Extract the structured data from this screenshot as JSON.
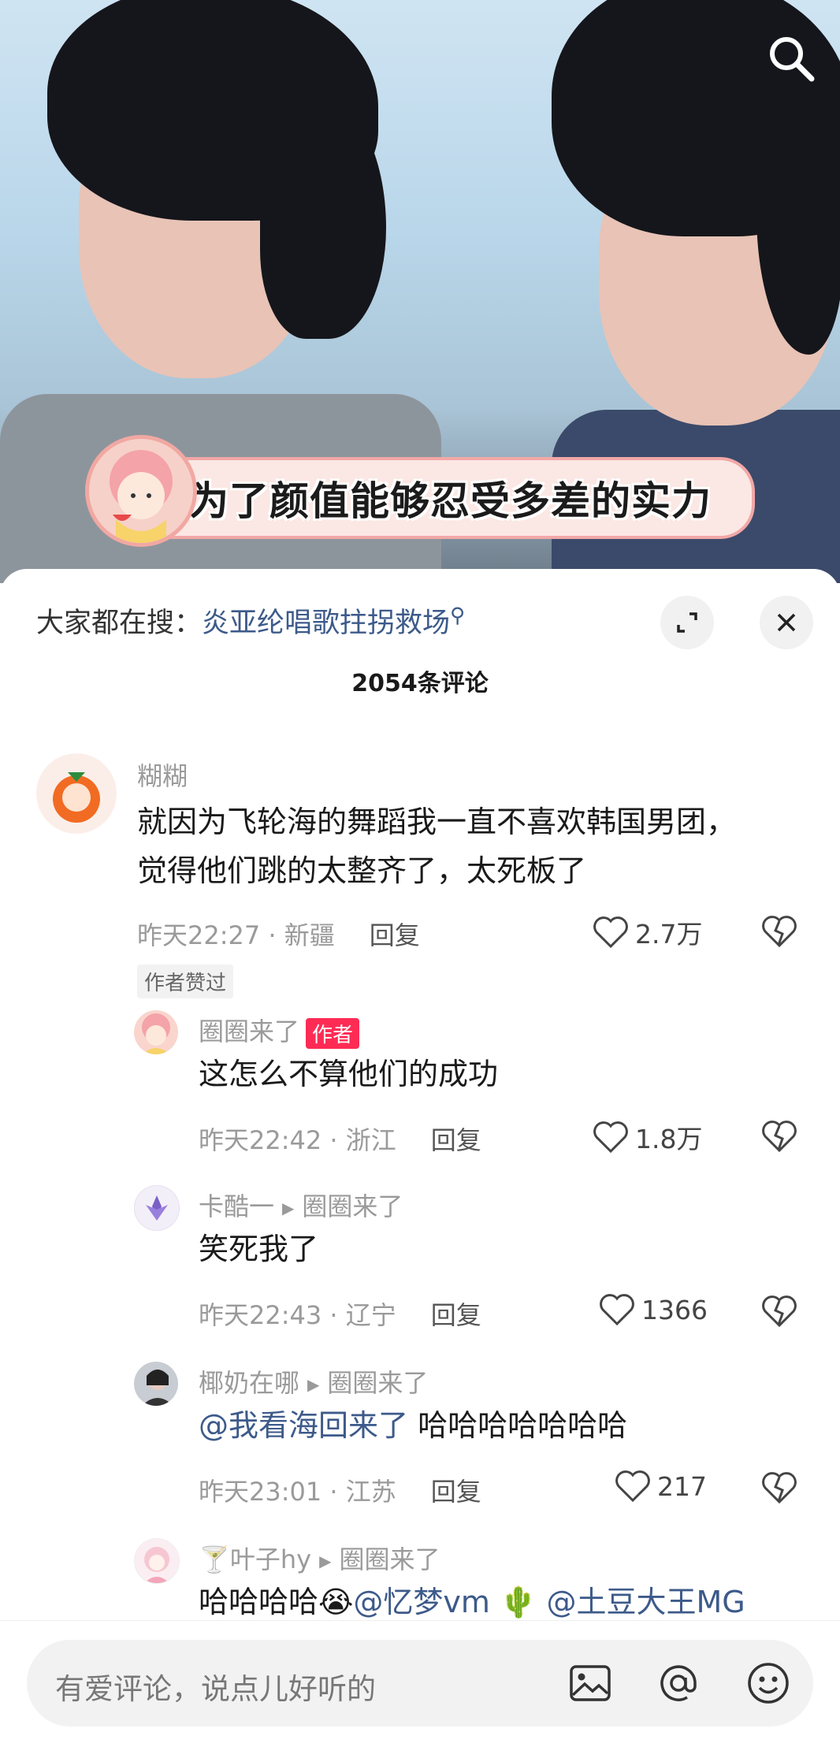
{
  "video": {
    "caption": "为了颜值能够忍受多差的实力"
  },
  "sheet": {
    "hot_search_label": "大家都在搜：",
    "hot_search_query": "炎亚纶唱歌拄拐救场",
    "comment_count": "2054条评论"
  },
  "comments": [
    {
      "user": "糊糊",
      "text_lines": [
        "就因为飞轮海的舞蹈我一直不喜欢韩国男团，",
        "觉得他们跳的太整齐了，太死板了"
      ],
      "time_loc": "昨天22:27 · 新疆",
      "reply": "回复",
      "likes": "2.7万",
      "badge": "作者赞过"
    },
    {
      "user": "圈圈来了",
      "tag": "作者",
      "text": "这怎么不算他们的成功",
      "time_loc": "昨天22:42 · 浙江",
      "reply": "回复",
      "likes": "1.8万"
    },
    {
      "user": "卡酷一",
      "reply_to": "圈圈来了",
      "text": "笑死我了",
      "time_loc": "昨天22:43 · 辽宁",
      "reply": "回复",
      "likes": "1366"
    },
    {
      "user": "椰奶在哪",
      "reply_to": "圈圈来了",
      "mention": "@我看海回来了",
      "text": " 哈哈哈哈哈哈哈",
      "time_loc": "昨天23:01 · 江苏",
      "reply": "回复",
      "likes": "217"
    },
    {
      "user": "叶子hy",
      "user_prefix": "🍸",
      "reply_to": "圈圈来了",
      "text": "哈哈哈哈😭",
      "mention1": "@忆梦vm",
      "emoji": "🌵",
      "mention2": "@土豆大王MG"
    }
  ],
  "input": {
    "placeholder": "有爱评论，说点儿好听的"
  },
  "icons": [
    "search-icon",
    "expand-icon",
    "close-icon",
    "heart-icon",
    "broken-heart-icon",
    "image-icon",
    "at-icon",
    "emoji-icon"
  ]
}
